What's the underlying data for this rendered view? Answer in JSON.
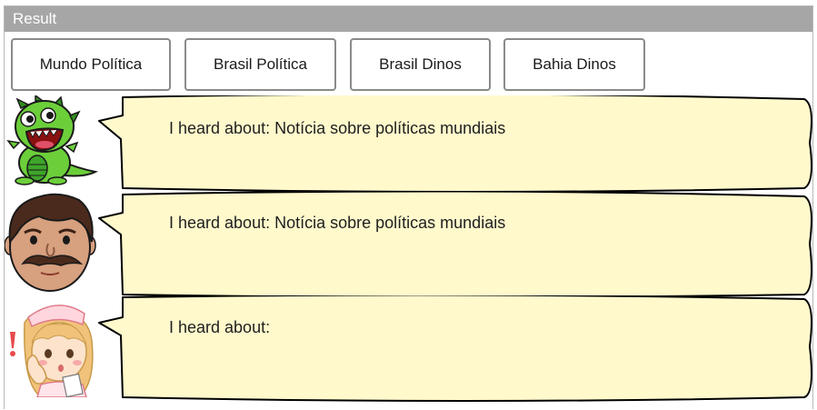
{
  "window": {
    "title": "Result"
  },
  "buttons": [
    {
      "label": "Mundo Política"
    },
    {
      "label": "Brasil Política"
    },
    {
      "label": "Brasil Dinos"
    },
    {
      "label": "Bahia Dinos"
    }
  ],
  "subscribers": [
    {
      "avatar": "dinosaur-avatar-icon",
      "message": "I heard about: Notícia sobre políticas mundiais"
    },
    {
      "avatar": "mustache-man-avatar-icon",
      "message": "I heard about: Notícia sobre políticas mundiais"
    },
    {
      "avatar": "nurse-avatar-icon",
      "message": "I heard about:"
    }
  ],
  "colors": {
    "titlebar": "#a6a6a6",
    "bubble_fill": "#fff9cc",
    "bubble_stroke": "#000000",
    "button_border": "#8a8a8a"
  }
}
